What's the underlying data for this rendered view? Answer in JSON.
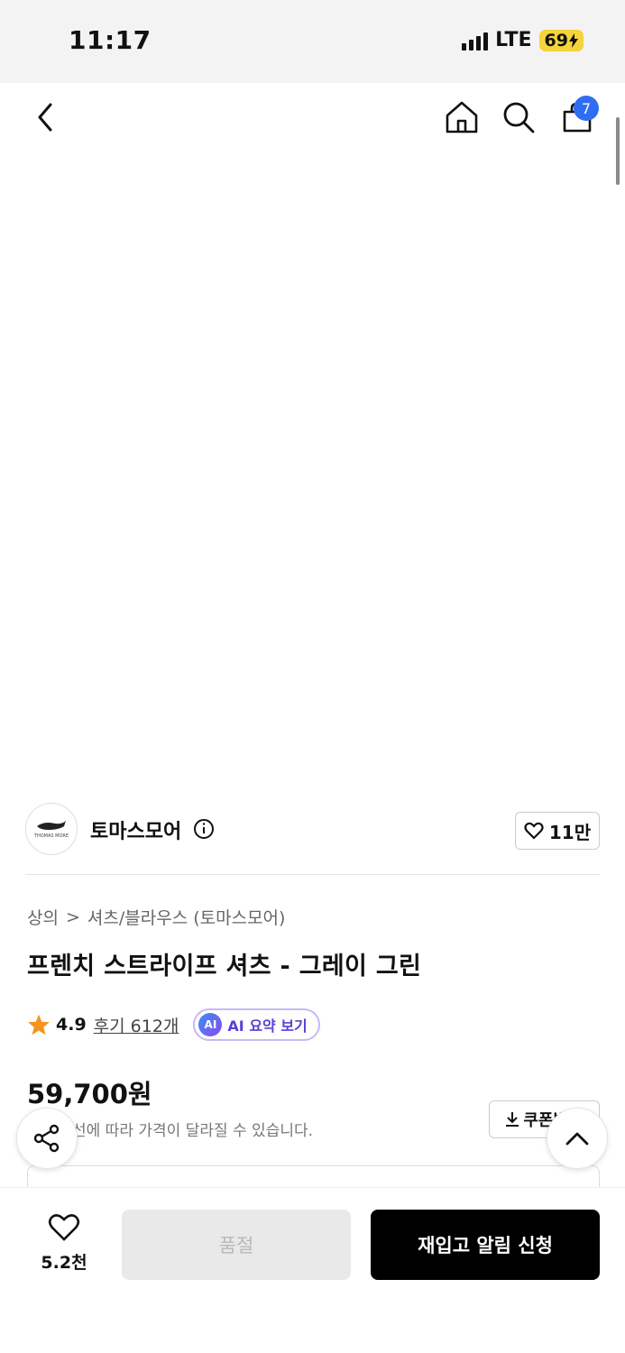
{
  "status_bar": {
    "time": "11:17",
    "network": "LTE",
    "battery": "69"
  },
  "header": {
    "cart_count": "7"
  },
  "brand": {
    "name": "토마스모어",
    "logo_text": "THOMAS MORE",
    "likes": "11만"
  },
  "breadcrumb": {
    "category": "상의",
    "separator": ">",
    "subcategory": "셔츠/블라우스 (토마스모어)"
  },
  "product": {
    "title": "프렌치 스트라이프 셔츠 - 그레이 그린",
    "rating": "4.9",
    "reviews": "후기 612개",
    "ai_badge": "AI",
    "ai_summary": "AI 요약 보기",
    "price": "59,700원",
    "price_note": "선에 따라 가격이 달라질 수 있습니다.",
    "coupon": "쿠폰받기"
  },
  "bottom_bar": {
    "wish_count": "5.2천",
    "soldout_label": "품절",
    "restock_label": "재입고 알림 신청"
  },
  "icons": [
    "back-icon",
    "home-icon",
    "search-icon",
    "cart-icon",
    "expand-icon",
    "info-icon",
    "heart-icon",
    "star-icon",
    "share-icon",
    "chevron-up-icon",
    "download-icon"
  ],
  "colors": {
    "accent_blue": "#2f6df2",
    "star": "#f7931e",
    "ai_purple": "#5a3fd8",
    "primary_button": "#000000"
  }
}
